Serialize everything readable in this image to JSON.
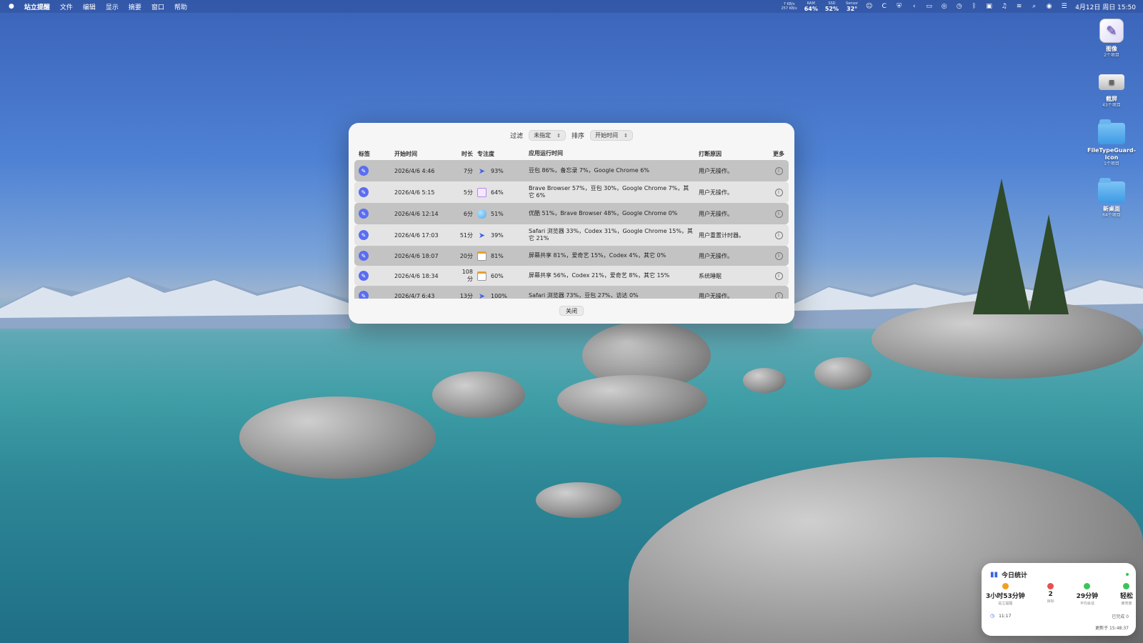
{
  "menubar": {
    "apple": "",
    "app_name": "站立提醒",
    "menus": [
      "文件",
      "编辑",
      "显示",
      "摘要",
      "窗口",
      "帮助"
    ],
    "net_up": "7 KB/s",
    "net_down": "257 KB/s",
    "ram_label": "RAM",
    "ram_value": "64%",
    "ssd_label": "SSD",
    "ssd_value": "52%",
    "sensor_label": "Sensor",
    "sensor_value": "32°",
    "datetime": "4月12日 周日 15:50"
  },
  "desktop": {
    "items": [
      {
        "name": "图像",
        "sub": "2个项目",
        "icon": "image-file-icon"
      },
      {
        "name": "截屏",
        "sub": "43个项目",
        "icon": "drive-icon"
      },
      {
        "name": "FileTypeGuard-icon",
        "sub": "1个项目",
        "icon": "folder-icon"
      },
      {
        "name": "新桌面",
        "sub": "64个项目",
        "icon": "folder-icon"
      }
    ]
  },
  "dialog": {
    "filter_label": "过滤",
    "filter_value": "未指定",
    "sort_label": "排序",
    "sort_value": "开始时间",
    "columns": {
      "tag": "标签",
      "start": "开始时间",
      "duration": "时长",
      "focus": "专注度",
      "apps": "应用运行时间",
      "reason": "打断原因",
      "more": "更多"
    },
    "rows": [
      {
        "start": "2026/4/6 4:46",
        "duration": "7分",
        "focus_icon": "plane",
        "focus": "93%",
        "apps": "豆包 86%，备忘录 7%，Google Chrome 6%",
        "reason": "用户无操作。"
      },
      {
        "start": "2026/4/6 5:15",
        "duration": "5分",
        "focus_icon": "box",
        "focus": "64%",
        "apps": "Brave Browser 57%，豆包 30%，Google Chrome 7%，其它 6%",
        "reason": "用户无操作。"
      },
      {
        "start": "2026/4/6 12:14",
        "duration": "6分",
        "focus_icon": "ball",
        "focus": "51%",
        "apps": "优酷 51%，Brave Browser 48%，Google Chrome 0%",
        "reason": "用户无操作。"
      },
      {
        "start": "2026/4/6 17:03",
        "duration": "51分",
        "focus_icon": "plane",
        "focus": "39%",
        "apps": "Safari 浏览器 33%，Codex 31%，Google Chrome 15%，其它 21%",
        "reason": "用户重置计时器。"
      },
      {
        "start": "2026/4/6 18:07",
        "duration": "20分",
        "focus_icon": "cal",
        "focus": "81%",
        "apps": "屏幕共享 81%，爱奇艺 15%，Codex 4%，其它 0%",
        "reason": "用户无操作。"
      },
      {
        "start": "2026/4/6 18:34",
        "duration": "108分",
        "focus_icon": "cal",
        "focus": "60%",
        "apps": "屏幕共享 56%，Codex 21%，爱奇艺 8%，其它 15%",
        "reason": "系统睡眠"
      },
      {
        "start": "2026/4/7 6:43",
        "duration": "13分",
        "focus_icon": "plane",
        "focus": "100%",
        "apps": "Safari 浏览器 73%，豆包 27%，访达 0%",
        "reason": "用户无操作。"
      }
    ],
    "close_label": "关闭"
  },
  "widget": {
    "title": "今日统计",
    "stats": [
      {
        "value": "3小时53分钟",
        "label": "站立提醒",
        "color": "#f0a020"
      },
      {
        "value": "2",
        "label": "目标",
        "color": "#e85050"
      },
      {
        "value": "29分钟",
        "label": "平均会话",
        "color": "#3bc45a"
      },
      {
        "value": "轻松",
        "label": "疲劳度",
        "color": "#3bc45a"
      }
    ],
    "time": "11:17",
    "done": "已完成 0",
    "updated": "更新于 15:48:37"
  },
  "colors": {
    "accent": "#5b6ef0",
    "row_dark": "#c3c3c3",
    "row_light": "#e4e4e4"
  }
}
